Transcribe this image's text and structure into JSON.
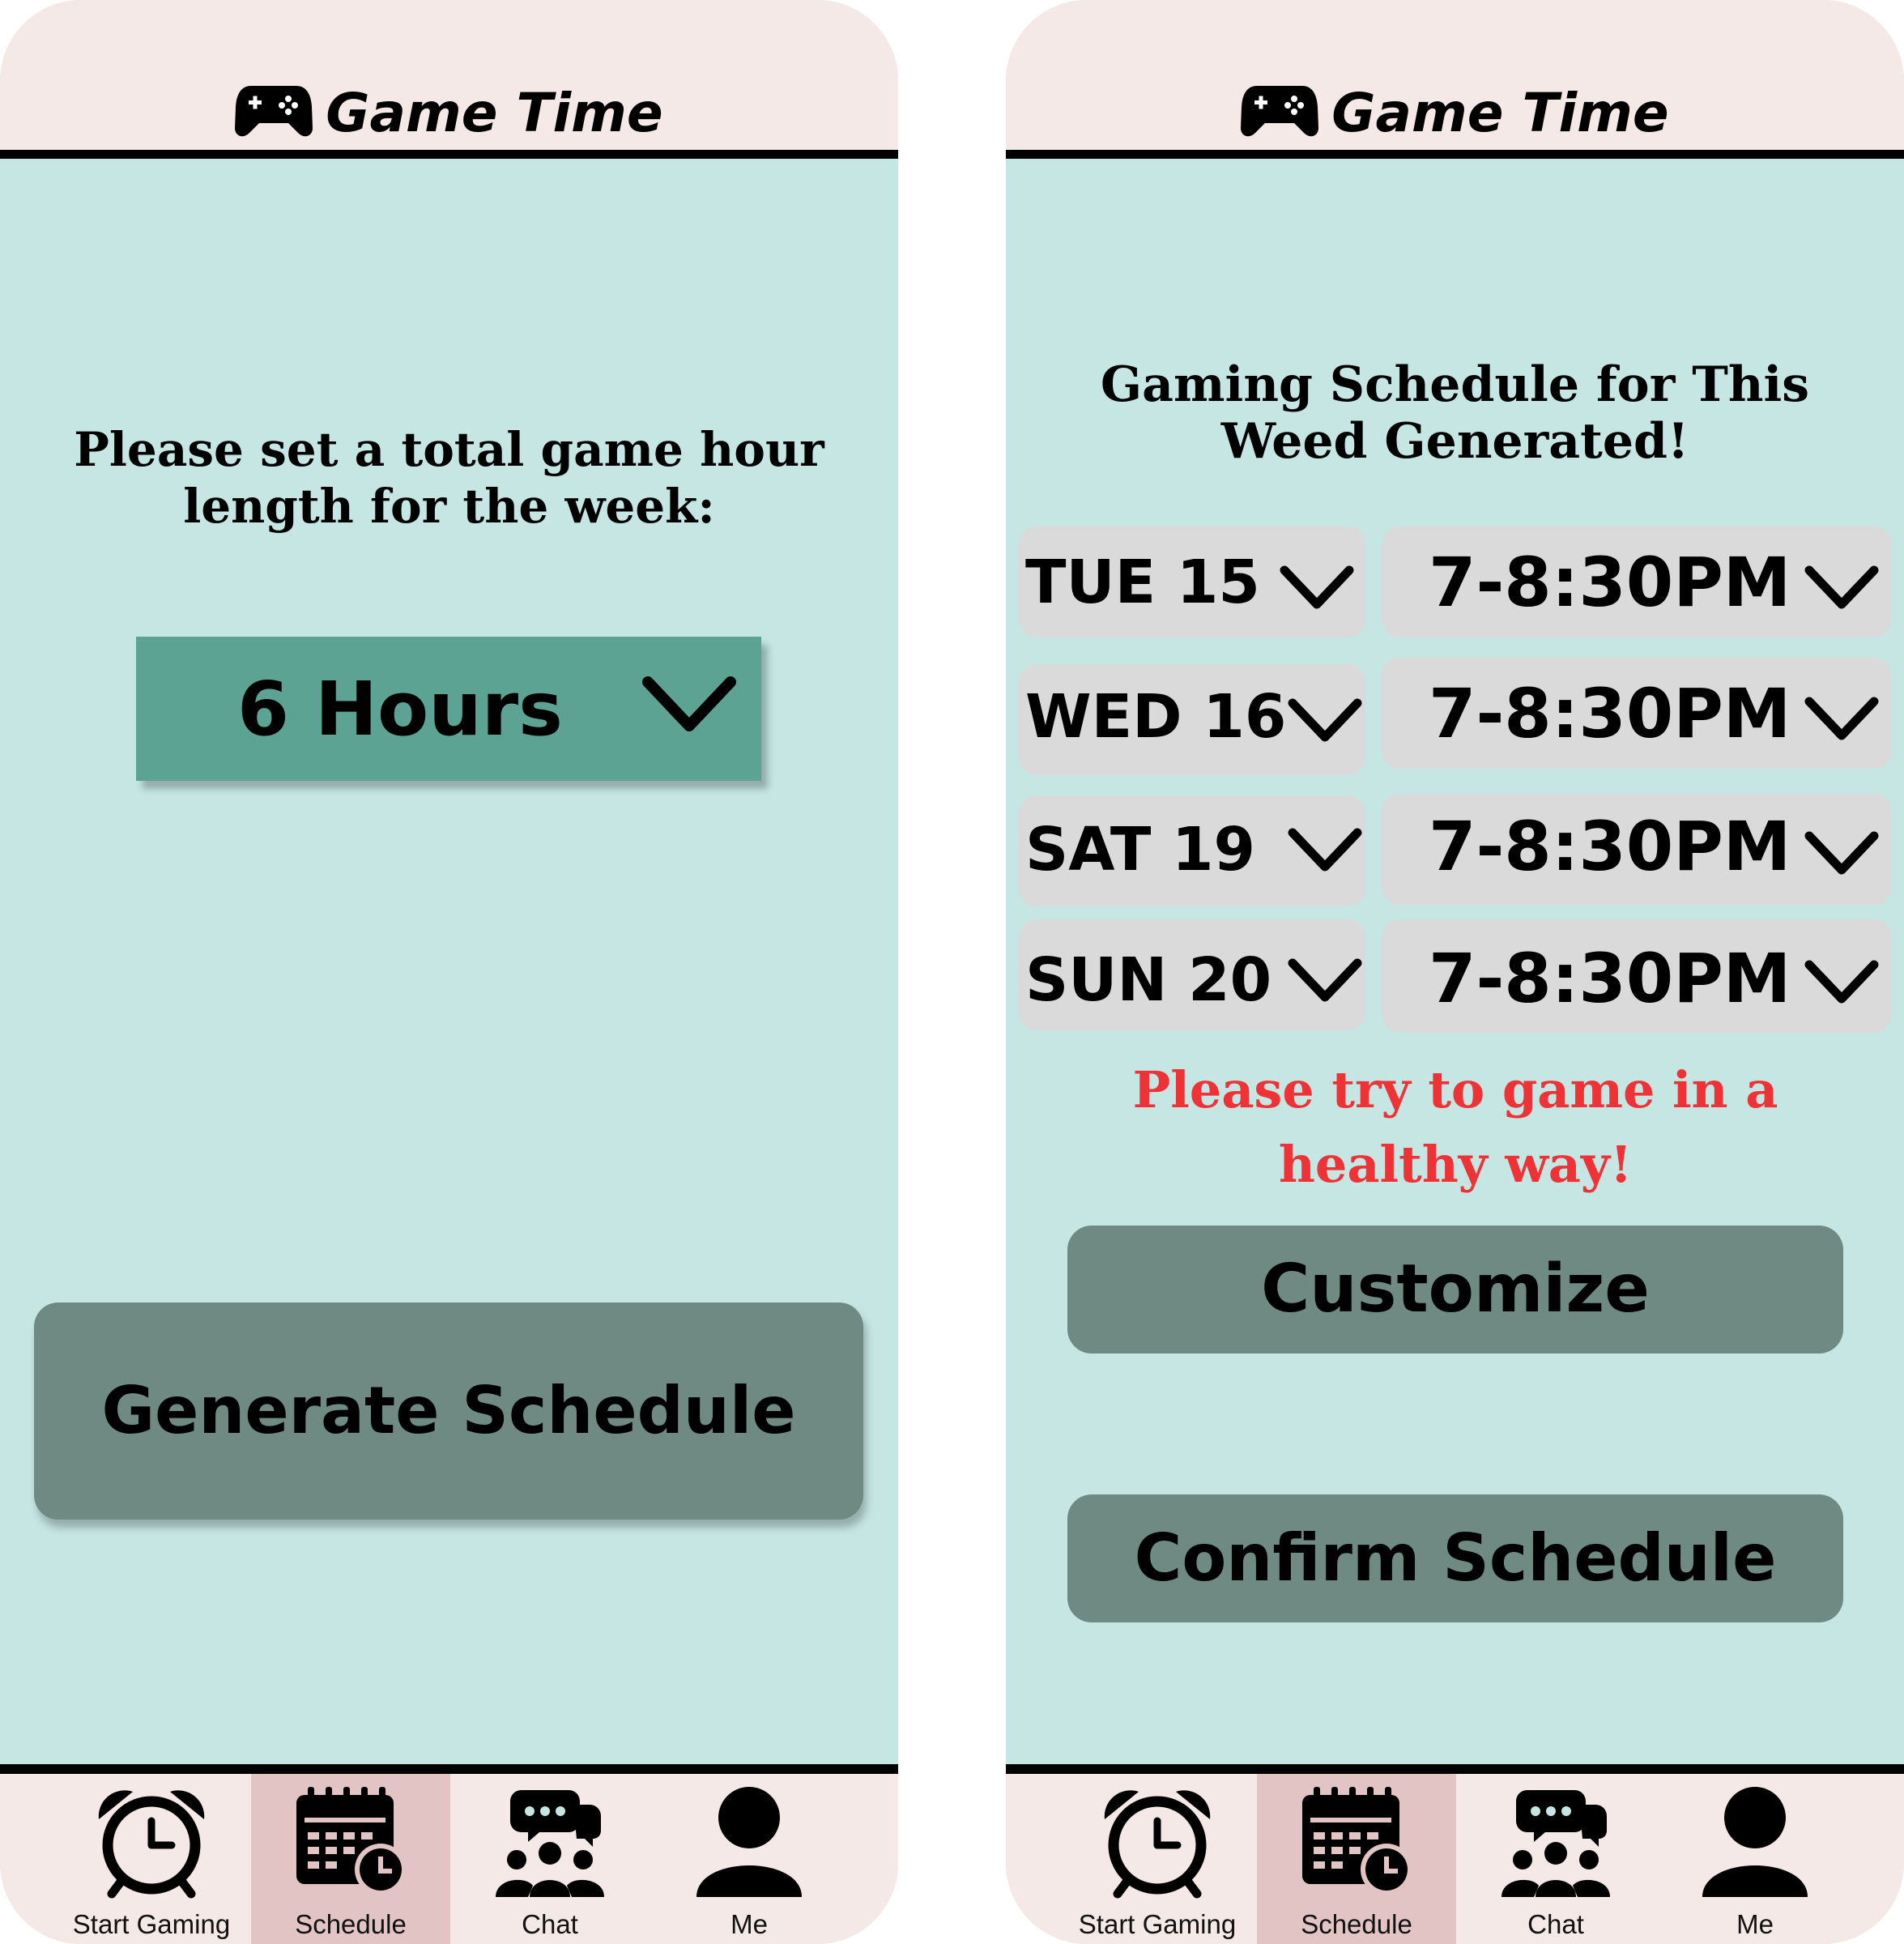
{
  "app": {
    "title": "Game Time"
  },
  "left_screen": {
    "prompt": "Please set a total game hour length for the week:",
    "hours_value": "6 Hours",
    "generate_label": "Generate Schedule"
  },
  "right_screen": {
    "heading": "Gaming Schedule for This Weed Generated!",
    "slots": [
      {
        "day": "TUE 15",
        "time": "7-8:30PM"
      },
      {
        "day": "WED 16",
        "time": "7-8:30PM"
      },
      {
        "day": "SAT 19",
        "time": "7-8:30PM"
      },
      {
        "day": "SUN 20",
        "time": "7-8:30PM"
      }
    ],
    "warning": "Please try to game in a healthy way!",
    "warning_color": "#ee3236",
    "customize_label": "Customize",
    "confirm_label": "Confirm Schedule"
  },
  "nav": {
    "items": [
      {
        "label": "Start Gaming",
        "icon": "alarm-clock-icon"
      },
      {
        "label": "Schedule",
        "icon": "calendar-clock-icon",
        "active": true
      },
      {
        "label": "Chat",
        "icon": "group-chat-icon"
      },
      {
        "label": "Me",
        "icon": "user-icon"
      }
    ]
  },
  "colors": {
    "header_bg": "#f5e9e8",
    "body_bg": "#c6e6e3",
    "select_bg": "#5da394",
    "button_bg": "#6e8a82",
    "pill_bg": "#dadada",
    "active_tab_bg": "#e2c4c5"
  }
}
